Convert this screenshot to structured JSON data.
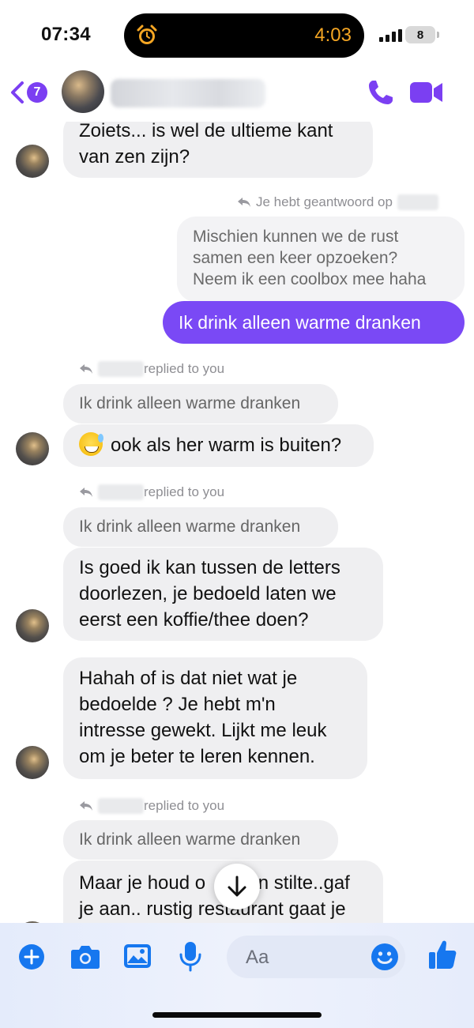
{
  "status_bar": {
    "time": "07:34",
    "timer": "4:03",
    "battery": "8"
  },
  "header": {
    "unread_count": "7",
    "contact_name": "",
    "accent_color": "#7b3ff2"
  },
  "messages": {
    "m1_text": "Zoiets... is wel de ultieme kant\nvan zen zijn?",
    "reply_note_you": "Je hebt geantwoord op",
    "quoted_own": "Mischien kunnen we de rust\nsamen een keer opzoeken?\nNeem ik een coolbox mee haha",
    "sent_text": "Ik drink alleen warme dranken",
    "reply_note_1": "replied to you",
    "quote_1": "Ik drink alleen warme dranken",
    "m2_text": "ook als her warm is buiten?",
    "reply_note_2": "replied to you",
    "quote_2": "Ik drink alleen warme dranken",
    "m3_text": "Is goed ik kan tussen de letters\ndoorlezen,  je bedoeld laten we\neerst een koffie/thee doen?",
    "m4_text": "Hahah of is dat niet wat je\nbedoelde ?   Je hebt m'n\nintresse gewekt. Lijkt me leuk\nom je beter te leren  kennen.",
    "reply_note_3": "replied to you",
    "quote_3": "Ik drink alleen warme dranken",
    "m5_text": "Maar je houd o          n stilte..gaf\nje aan.. rustig restaurant gaat je"
  },
  "composer": {
    "placeholder": "Aa",
    "icons": [
      "plus-icon",
      "camera-icon",
      "gallery-icon",
      "microphone-icon",
      "emoji-icon",
      "thumbs-up-icon"
    ],
    "icon_color": "#1677ef"
  }
}
